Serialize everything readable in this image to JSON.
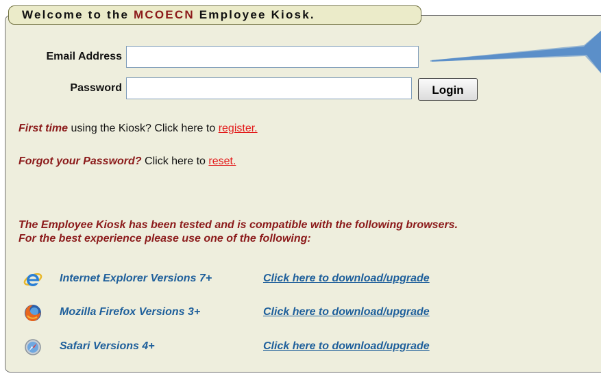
{
  "header": {
    "prefix": "Welcome to the ",
    "brand": "MCOECN",
    "suffix": " Employee Kiosk."
  },
  "login": {
    "email_label": "Email Address",
    "email_value": "",
    "password_label": "Password",
    "password_value": "",
    "login_button": "Login"
  },
  "first_time": {
    "emphasis": "First time",
    "text": " using the Kiosk? Click here to ",
    "link": "register."
  },
  "forgot": {
    "emphasis": "Forgot your Password?",
    "text": " Click here to ",
    "link": "reset."
  },
  "notice": {
    "line1": "The Employee Kiosk has been tested and is compatible with the following browsers.",
    "line2": "For the best experience please use one of the following:"
  },
  "browsers": [
    {
      "icon": "internet-explorer-icon",
      "name": "Internet Explorer Versions 7+",
      "link": "Click here to download/upgrade"
    },
    {
      "icon": "firefox-icon",
      "name": "Mozilla Firefox Versions 3+",
      "link": "Click here to download/upgrade"
    },
    {
      "icon": "safari-icon",
      "name": "Safari Versions 4+",
      "link": "Click here to download/upgrade"
    }
  ],
  "colors": {
    "panel_background": "#eeeedd",
    "brand": "#8b1a1a",
    "link_red": "#e31a1a",
    "link_blue": "#1e5f9b",
    "callout": "#5b8fc9"
  }
}
